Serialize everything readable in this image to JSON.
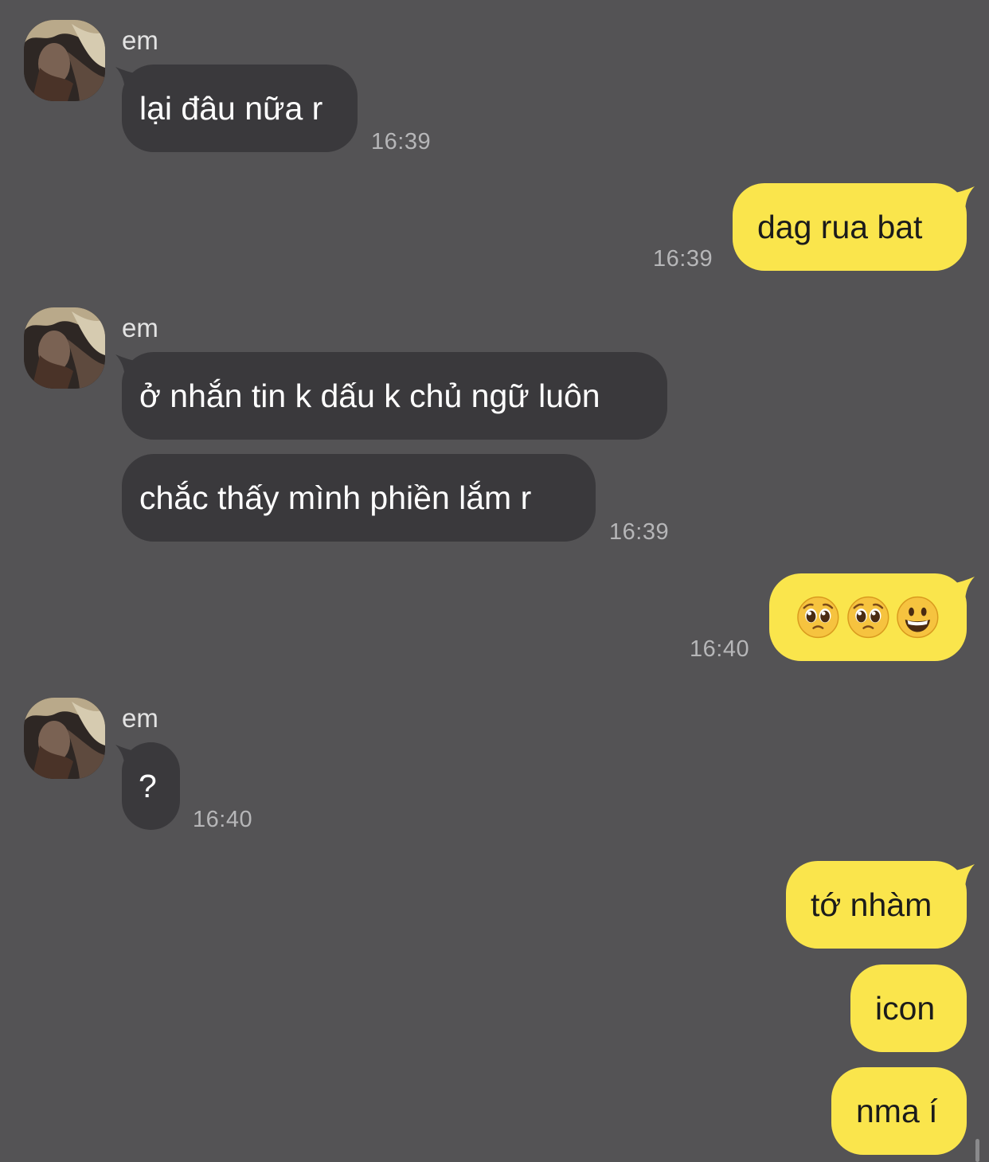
{
  "chat": {
    "messages": [
      {
        "sender": "em",
        "text": "lại đâu nữa r",
        "time": "16:39"
      },
      {
        "text": "dag rua bat",
        "time": "16:39"
      },
      {
        "sender": "em",
        "text": "ở nhắn tin k dấu k chủ ngữ luôn"
      },
      {
        "text": "chắc thấy mình phiền lắm r",
        "time": "16:39"
      },
      {
        "emojis": [
          "pleading-face",
          "pleading-face",
          "grinning-face"
        ],
        "time": "16:40"
      },
      {
        "sender": "em",
        "text": "?",
        "time": "16:40"
      },
      {
        "text": "tớ nhàm"
      },
      {
        "text": "icon"
      },
      {
        "text": "nma í"
      }
    ]
  },
  "colors": {
    "background": "#545355",
    "incoming_bubble": "#3a393c",
    "outgoing_bubble": "#fae54c",
    "timestamp": "#b6b6b8"
  }
}
